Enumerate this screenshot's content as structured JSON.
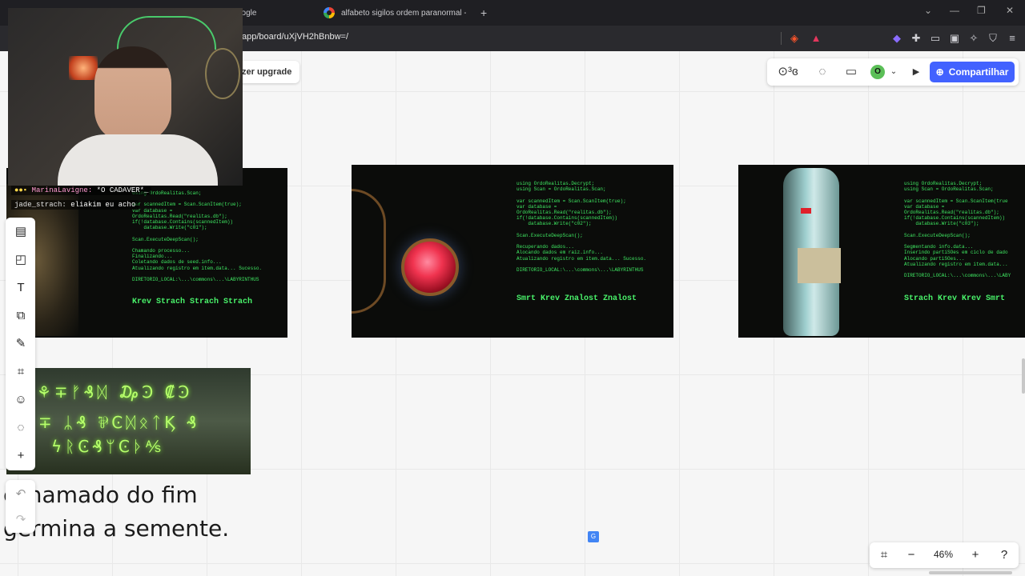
{
  "browser": {
    "tabs": [
      {
        "title": "oogle",
        "active": false
      },
      {
        "title": "alfabeto sigilos ordem paranormal - Pesquis",
        "active": false
      }
    ],
    "new_tab_label": "+",
    "url": "app/board/uXjVH2hBnbw=/"
  },
  "board": {
    "upgrade_label": "zer upgrade",
    "share_label": "Compartilhar",
    "user_initial": "O",
    "zoom": "46%"
  },
  "stream": {
    "chat_line1_user": "MarinaLavigne:",
    "chat_line1_text": "*O CADAVER*_",
    "chat_line2_user": "jade_strach:",
    "chat_line2_text": "eliakim eu acho"
  },
  "images": {
    "panel1_code": "using OrdoRealitas.Scan;\n\nvar scannedItem = Scan.ScanItem(true);\nvar database =\nOrdoRealitas.Read(\"realitas.db\");\nif(!database.Contains(scannedItem))\n    database.Write(\"c01\");\n\nScan.ExecuteDeepScan();\n\nChamando processo...\nFinalizando...\nColetando dados de seed.info...\nAtualizando registro em item.data... Sucesso.\n\nDIRETORIO_LOCAL:\\...\\commons\\...\\LABYRINTHUS",
    "panel1_phrase": "Krev Strach Strach Strach",
    "panel2_code": "using OrdoRealitas.Decrypt;\nusing Scan = OrdoRealitas.Scan;\n\nvar scannedItem = Scan.ScanItem(true);\nvar database =\nOrdoRealitas.Read(\"realitas.db\");\nif(!database.Contains(scannedItem))\n    database.Write(\"c02\");\n\nScan.ExecuteDeepScan();\n\nRecuperando dados...\nAlocando dados em raiz.info...\nAtualizando registro em item.data... Sucesso.\n\nDIRETORIO_LOCAL:\\...\\commons\\...\\LABYRINTHUS",
    "panel2_phrase": "Smrt Krev Znalost Znalost",
    "panel3_code": "using OrdoRealitas.Decrypt;\nusing Scan = OrdoRealitas.Scan;\n\nvar scannedItem = Scan.ScanItem(true\nvar database =\nOrdoRealitas.Read(\"realitas.db\");\nif(!database.Contains(scannedItem))\n    database.Write(\"c03\");\n\nScan.ExecuteDeepScan();\n\nSegmentando info.data...\nInserindo partiSOes em ciclo de dado\nAlocando partiSOes...\nAtualizando registro em item.data...\n\nDIRETORIO_LOCAL:\\...\\commons\\...\\LABY",
    "panel3_phrase": "Strach Krev Krev Smrt",
    "glyph_rows": [
      "⚘∓ᚠ₰ᛞ ₯Ͽ ₡Ͽ",
      "∓ ᛦ₰ ⅌ϾᛞᛟᛏϏ ₰",
      "ϟᚱϾ₰ᛘϾᚦ⅍"
    ]
  },
  "text_blocks": {
    "line1": "chamado do fim",
    "line2": "germina a semente."
  },
  "colors": {
    "share_button": "#4262ff",
    "terminal_green": "#3fe862",
    "avatar_green": "#5bbf57"
  }
}
